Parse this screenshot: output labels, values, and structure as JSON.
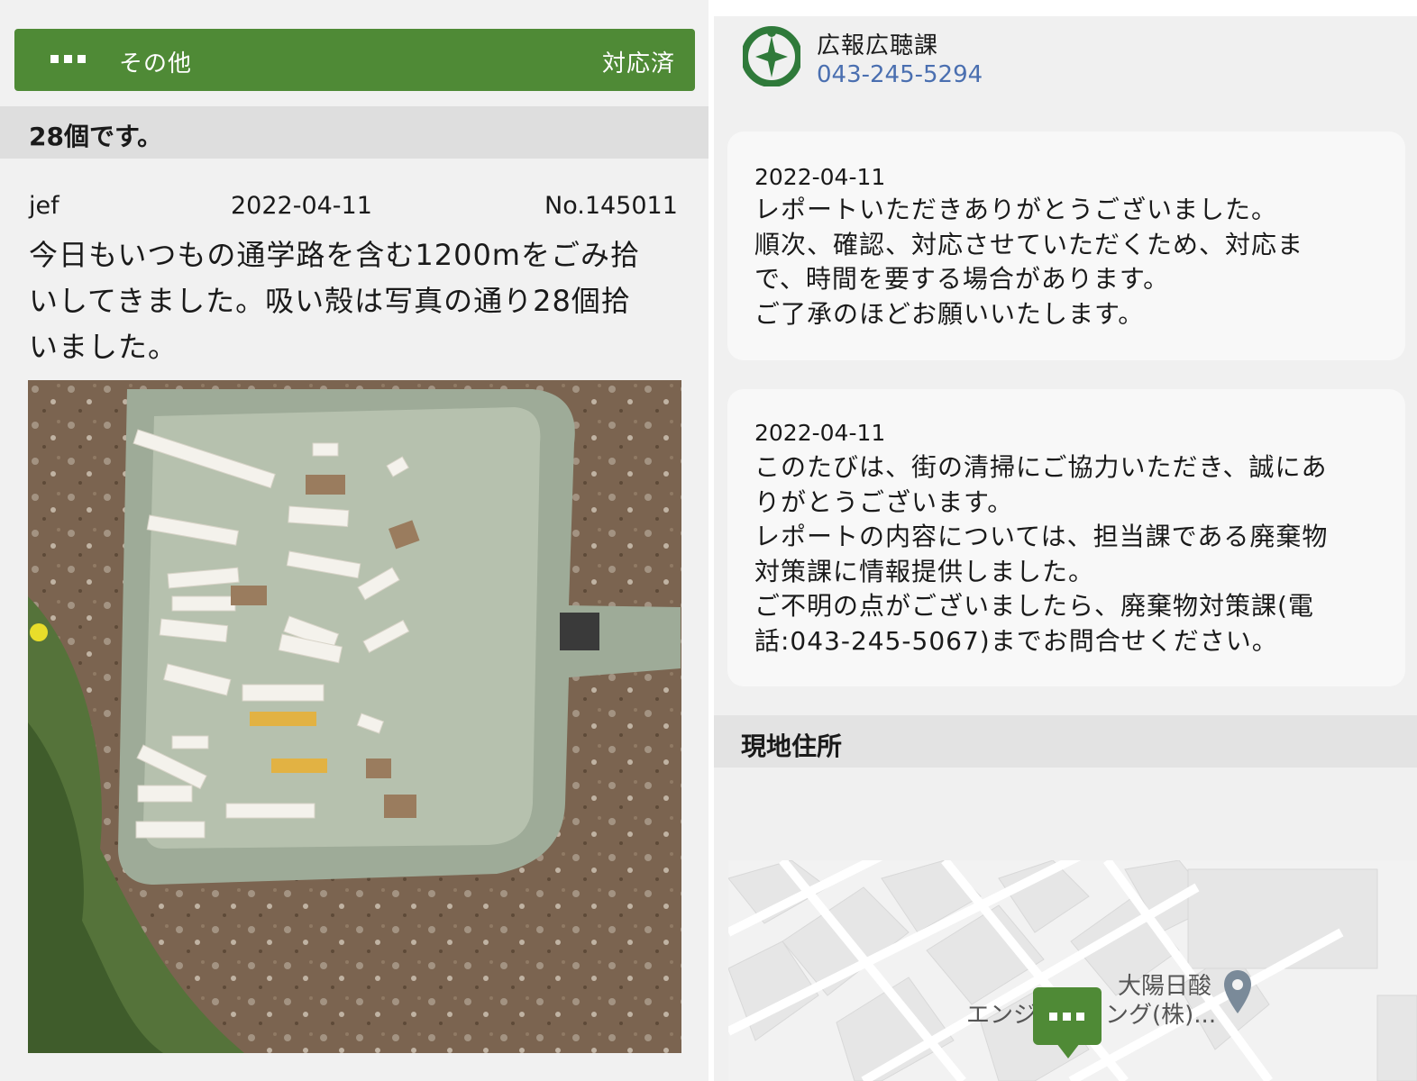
{
  "report": {
    "category": "その他",
    "status": "対応済",
    "title": "28個です。",
    "user": "jef",
    "date": "2022-04-11",
    "number": "No.145011",
    "body_lines": [
      "今日もいつもの通学路を含む1200mをごみ拾",
      "いしてきました。吸い殻は写真の通り28個拾",
      "いました。"
    ]
  },
  "responder": {
    "department": "広報広聴課",
    "phone": "043-245-5294",
    "logo_icon": "chiba-city-emblem-icon"
  },
  "replies": [
    {
      "date": "2022-04-11",
      "lines": [
        "レポートいただきありがとうございました。",
        "順次、確認、対応させていただくため、対応ま",
        "で、時間を要する場合があります。",
        "ご了承のほどお願いいたします。"
      ]
    },
    {
      "date": "2022-04-11",
      "lines": [
        "このたびは、街の清掃にご協力いただき、誠にあ",
        "りがとうございます。",
        "レポートの内容については、担当課である廃棄物",
        "対策課に情報提供しました。",
        "ご不明の点がございましたら、廃棄物対策課(電",
        "話:043-245-5067)までお問合せください。"
      ]
    }
  ],
  "address": {
    "title": "現地住所",
    "map_poi_line1": "大陽日酸",
    "map_poi_line2": "ング(株)...",
    "map_poi_prefix": "エンジ"
  },
  "colors": {
    "accent_green": "#4f8a36",
    "phone_blue": "#4a6fb0"
  }
}
